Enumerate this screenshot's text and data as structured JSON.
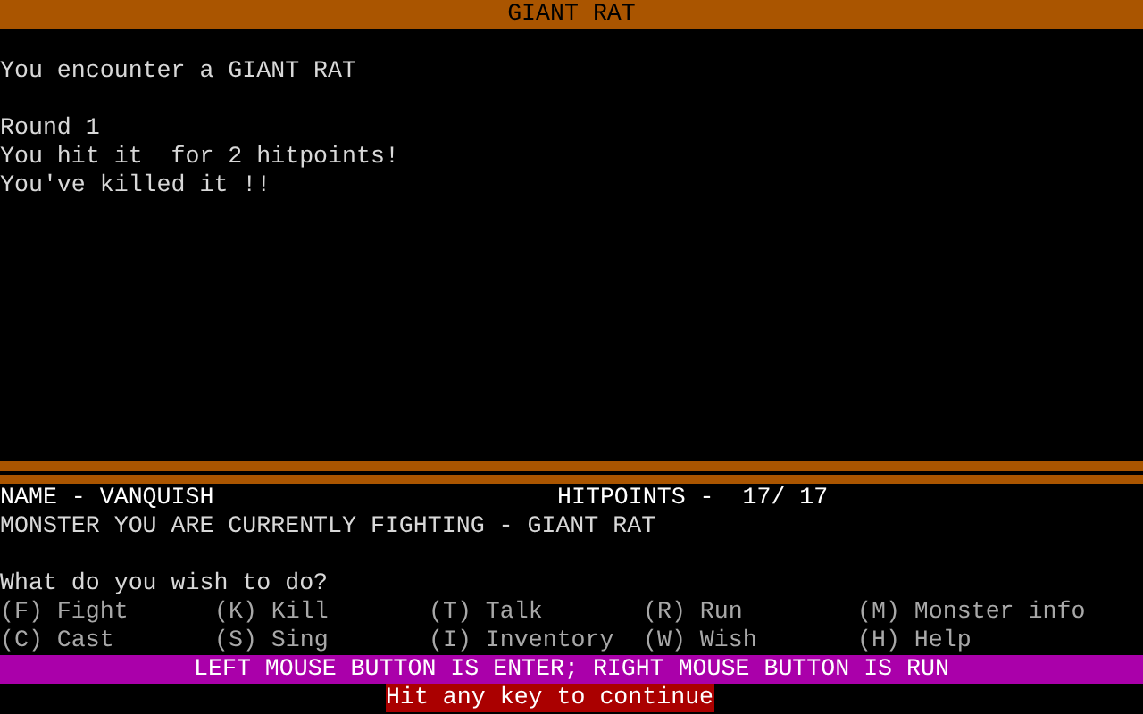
{
  "title_bar": {
    "title": "GIANT RAT"
  },
  "message_log": [
    {
      "lines": [
        "You encounter a GIANT RAT"
      ]
    },
    {
      "lines": [
        "Round 1",
        "You hit it  for 2 hitpoints!",
        "You've killed it !!"
      ]
    }
  ],
  "status": {
    "name": "NAME - VANQUISH",
    "hitpoints": "HITPOINTS -  17/ 17",
    "monster": "MONSTER YOU ARE CURRENTLY FIGHTING - GIANT RAT"
  },
  "prompt": "What do you wish to do?",
  "options": [
    {
      "label": "(F) Fight"
    },
    {
      "label": "(K) Kill"
    },
    {
      "label": "(T) Talk"
    },
    {
      "label": "(R) Run"
    },
    {
      "label": "(M) Monster info"
    },
    {
      "label": "(C) Cast"
    },
    {
      "label": "(S) Sing"
    },
    {
      "label": "(I) Inventory"
    },
    {
      "label": "(W) Wish"
    },
    {
      "label": "(H) Help"
    }
  ],
  "mouse_hint": "LEFT MOUSE BUTTON IS ENTER; RIGHT MOUSE BUTTON IS RUN",
  "continue_prompt": "Hit any key to continue"
}
